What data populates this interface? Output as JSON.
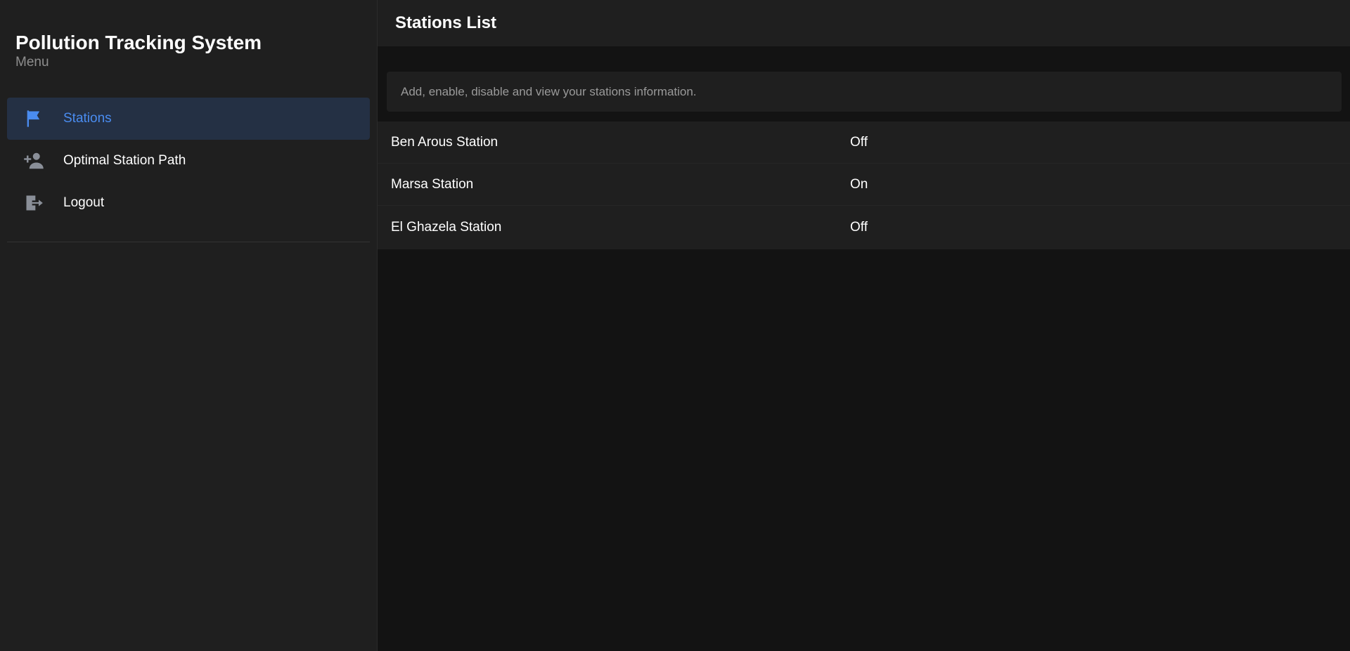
{
  "sidebar": {
    "title": "Pollution Tracking System",
    "subtitle": "Menu",
    "items": [
      {
        "label": "Stations",
        "icon": "flag-icon",
        "active": true
      },
      {
        "label": "Optimal Station Path",
        "icon": "add-user-icon",
        "active": false
      },
      {
        "label": "Logout",
        "icon": "logout-icon",
        "active": false
      }
    ]
  },
  "main": {
    "title": "Stations List",
    "info": "Add, enable, disable and view your stations information.",
    "stations": [
      {
        "name": "Ben Arous Station",
        "status": "Off"
      },
      {
        "name": "Marsa Station",
        "status": "On"
      },
      {
        "name": "El Ghazela Station",
        "status": "Off"
      }
    ]
  },
  "colors": {
    "accent": "#4a8cf0",
    "active_bg": "#243044",
    "panel_bg": "#1f1f1f",
    "page_bg": "#131313",
    "icon_gray": "#8a8f98"
  }
}
